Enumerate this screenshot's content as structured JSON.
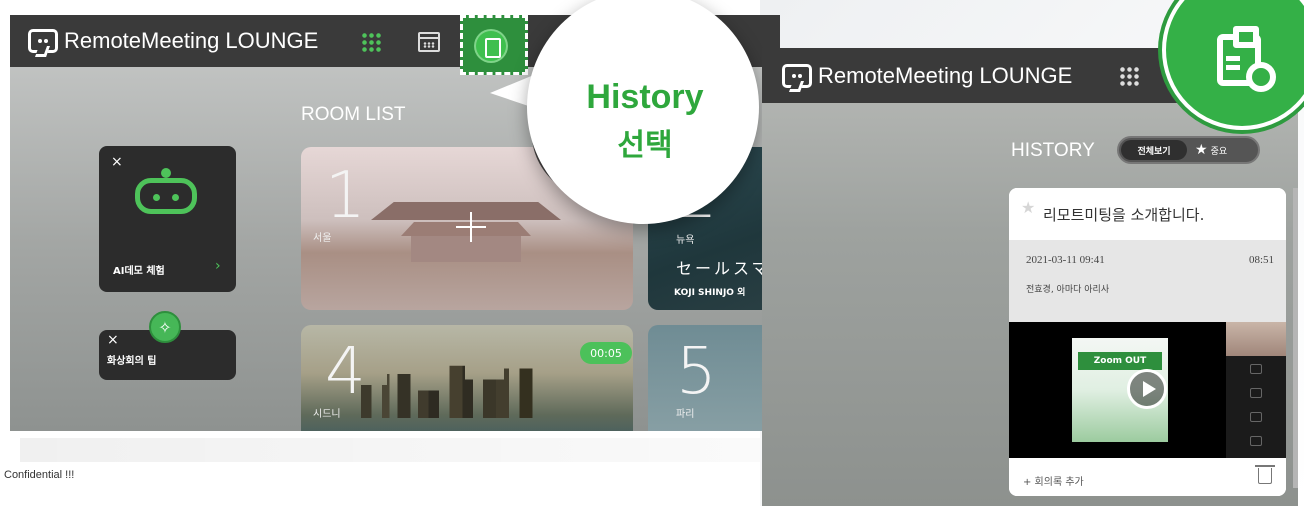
{
  "footer": {
    "confidential": "Confidential  !!!"
  },
  "left_app": {
    "brand": "RemoteMeeting LOUNGE",
    "room_list_title": "ROOM LIST",
    "ai_demo": {
      "label": "AI데모 체험",
      "close": "×",
      "arrow": "›"
    },
    "tips": {
      "label": "화상회의 팁",
      "close": "×"
    },
    "rooms": [
      {
        "number": "1",
        "city": "서울"
      },
      {
        "number": "2",
        "city": "뉴욕",
        "title": "セールスマ",
        "host": "KOJI SHINJO 외"
      },
      {
        "number": "4",
        "city": "시드니",
        "timer": "00:05"
      },
      {
        "number": "5",
        "city": "파리"
      }
    ]
  },
  "callout": {
    "line1": "History",
    "line2": "선택"
  },
  "right_app": {
    "brand": "RemoteMeeting LOUNGE",
    "history_title": "HISTORY",
    "toggle": {
      "all": "전체보기",
      "fav_star": "★",
      "fav": "중요"
    },
    "record": {
      "title": "리모트미팅을 소개합니다.",
      "datetime": "2021-03-11 09:41",
      "duration": "08:51",
      "participants": "전효경, 아마다 아리사",
      "video_banner": "Zoom OUT",
      "add_note": "+ 회의록 추가"
    }
  },
  "colors": {
    "accent": "#34b047",
    "appbar": "#3a3a3a"
  }
}
